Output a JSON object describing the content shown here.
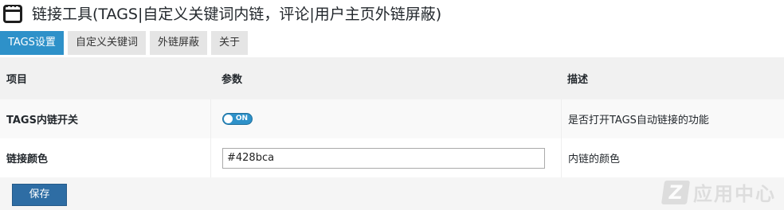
{
  "header": {
    "title": "链接工具(TAGS|自定义关键词内链，评论|用户主页外链屏蔽)",
    "icon": "window-icon"
  },
  "tabs": [
    {
      "label": "TAGS设置",
      "active": true
    },
    {
      "label": "自定义关键词",
      "active": false
    },
    {
      "label": "外链屏蔽",
      "active": false
    },
    {
      "label": "关于",
      "active": false
    }
  ],
  "table": {
    "headers": [
      "项目",
      "参数",
      "描述"
    ],
    "rows": [
      {
        "item": "TAGS内链开关",
        "param_type": "toggle",
        "toggle_state": "ON",
        "description": "是否打开TAGS自动链接的功能"
      },
      {
        "item": "链接颜色",
        "param_type": "text",
        "value": "#428bca",
        "description": "内链的颜色"
      }
    ]
  },
  "actions": {
    "save_label": "保存"
  },
  "watermark": {
    "text": "应用中心"
  },
  "colors": {
    "accent": "#2e91c9",
    "save_button": "#2e6da4",
    "header_row": "#f1f1f1",
    "tab_inactive": "#e5e5e5"
  }
}
